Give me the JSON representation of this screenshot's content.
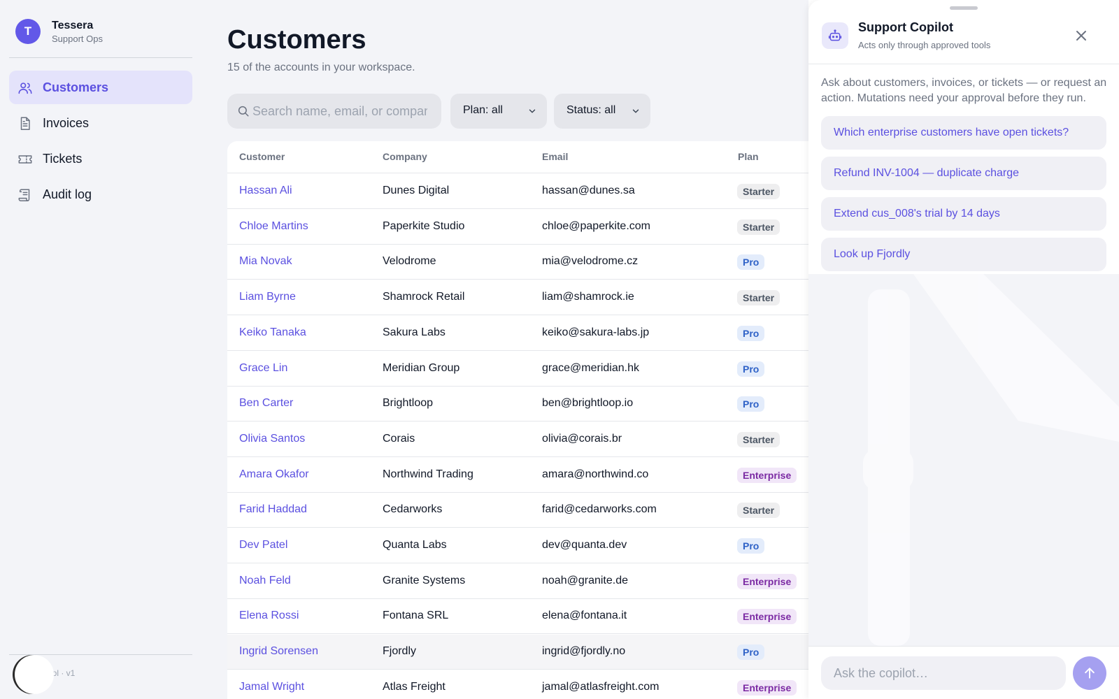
{
  "brand": {
    "initial": "T",
    "name": "Tessera",
    "subtitle": "Support Ops"
  },
  "sidebar": {
    "items": [
      {
        "label": "Customers",
        "icon": "users-icon",
        "active": true
      },
      {
        "label": "Invoices",
        "icon": "document-icon",
        "active": false
      },
      {
        "label": "Tickets",
        "icon": "ticket-icon",
        "active": false
      },
      {
        "label": "Audit log",
        "icon": "scroll-icon",
        "active": false
      }
    ],
    "footer_text": "ool · v1"
  },
  "main": {
    "title": "Customers",
    "subtitle": "15 of the accounts in your workspace.",
    "search_placeholder": "Search name, email, or company",
    "filters": {
      "plan": "Plan: all",
      "status": "Status: all"
    }
  },
  "table": {
    "columns": [
      "Customer",
      "Company",
      "Email",
      "Plan"
    ],
    "rows": [
      {
        "name": "Hassan Ali",
        "company": "Dunes Digital",
        "email": "hassan@dunes.sa",
        "plan": "Starter"
      },
      {
        "name": "Chloe Martins",
        "company": "Paperkite Studio",
        "email": "chloe@paperkite.com",
        "plan": "Starter"
      },
      {
        "name": "Mia Novak",
        "company": "Velodrome",
        "email": "mia@velodrome.cz",
        "plan": "Pro"
      },
      {
        "name": "Liam Byrne",
        "company": "Shamrock Retail",
        "email": "liam@shamrock.ie",
        "plan": "Starter"
      },
      {
        "name": "Keiko Tanaka",
        "company": "Sakura Labs",
        "email": "keiko@sakura-labs.jp",
        "plan": "Pro"
      },
      {
        "name": "Grace Lin",
        "company": "Meridian Group",
        "email": "grace@meridian.hk",
        "plan": "Pro"
      },
      {
        "name": "Ben Carter",
        "company": "Brightloop",
        "email": "ben@brightloop.io",
        "plan": "Pro"
      },
      {
        "name": "Olivia Santos",
        "company": "Corais",
        "email": "olivia@corais.br",
        "plan": "Starter"
      },
      {
        "name": "Amara Okafor",
        "company": "Northwind Trading",
        "email": "amara@northwind.co",
        "plan": "Enterprise"
      },
      {
        "name": "Farid Haddad",
        "company": "Cedarworks",
        "email": "farid@cedarworks.com",
        "plan": "Starter"
      },
      {
        "name": "Dev Patel",
        "company": "Quanta Labs",
        "email": "dev@quanta.dev",
        "plan": "Pro"
      },
      {
        "name": "Noah Feld",
        "company": "Granite Systems",
        "email": "noah@granite.de",
        "plan": "Enterprise"
      },
      {
        "name": "Elena Rossi",
        "company": "Fontana SRL",
        "email": "elena@fontana.it",
        "plan": "Enterprise"
      },
      {
        "name": "Ingrid Sorensen",
        "company": "Fjordly",
        "email": "ingrid@fjordly.no",
        "plan": "Pro",
        "highlighted": true
      },
      {
        "name": "Jamal Wright",
        "company": "Atlas Freight",
        "email": "jamal@atlasfreight.com",
        "plan": "Enterprise"
      }
    ]
  },
  "copilot": {
    "title": "Support Copilot",
    "subtitle": "Acts only through approved tools",
    "intro": "Ask about customers, invoices, or tickets — or request an action. Mutations need your approval before they run.",
    "suggestions": [
      "Which enterprise customers have open tickets?",
      "Refund INV-1004 — duplicate charge",
      "Extend cus_008's trial by 14 days",
      "Look up Fjordly"
    ],
    "input_placeholder": "Ask the copilot…"
  },
  "colors": {
    "accent": "#5b50e0",
    "brand_avatar": "#6258e8",
    "sidebar_bg": "#f3f4f8",
    "active_nav_bg": "#e4e3fb",
    "send_button": "#a5a0f0"
  }
}
